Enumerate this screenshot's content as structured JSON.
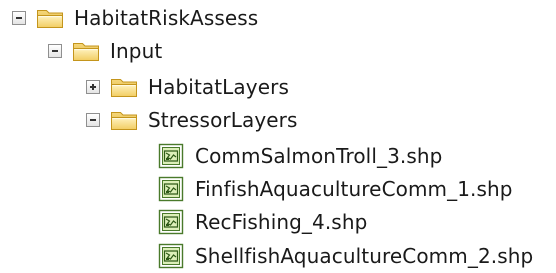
{
  "tree": {
    "root": {
      "label": "HabitatRiskAssess",
      "state": "expanded"
    },
    "input": {
      "label": "Input",
      "state": "expanded"
    },
    "habitat_layers": {
      "label": "HabitatLayers",
      "state": "collapsed"
    },
    "stressor_layers": {
      "label": "StressorLayers",
      "state": "expanded"
    },
    "files": [
      {
        "label": "CommSalmonTroll_3.shp",
        "icon": "shapefile-icon"
      },
      {
        "label": "FinfishAquacultureComm_1.shp",
        "icon": "shapefile-icon"
      },
      {
        "label": "RecFishing_4.shp",
        "icon": "shapefile-icon"
      },
      {
        "label": "ShellfishAquacultureComm_2.shp",
        "icon": "shapefile-icon"
      }
    ]
  },
  "colors": {
    "folder_fill": "#f7d46b",
    "folder_outline": "#c7991f",
    "shp_fill": "#e7f3c9",
    "shp_outline": "#3f6b25"
  }
}
